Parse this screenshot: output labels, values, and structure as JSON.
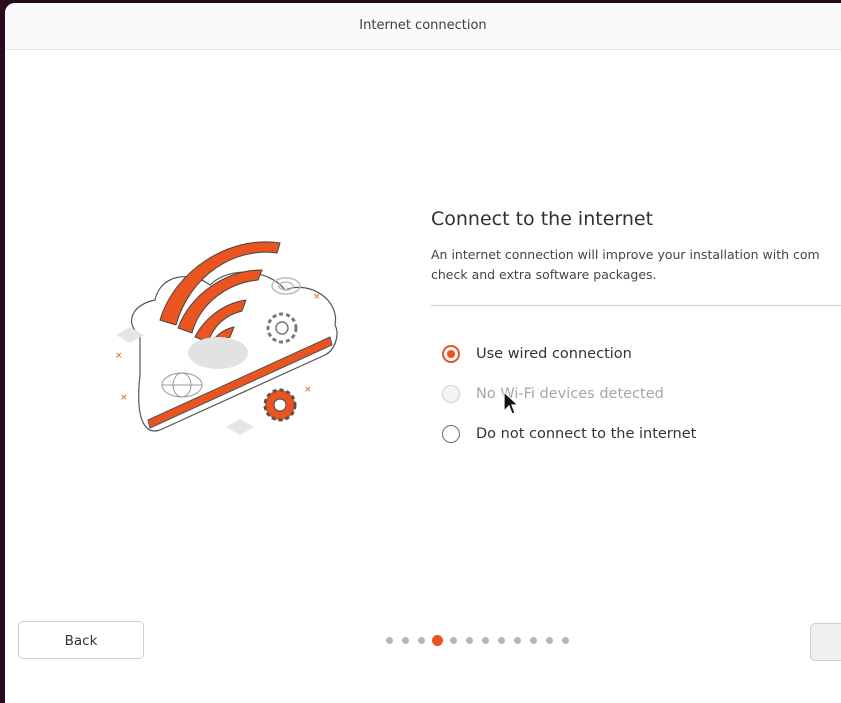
{
  "window": {
    "title": "Internet connection"
  },
  "main": {
    "heading": "Connect to the internet",
    "description_line1": "An internet connection will improve your installation with com",
    "description_line2": "check and extra software packages."
  },
  "options": [
    {
      "label": "Use wired connection",
      "state": "selected"
    },
    {
      "label": "No Wi-Fi devices detected",
      "state": "disabled"
    },
    {
      "label": "Do not connect to the internet",
      "state": "unselected"
    }
  ],
  "footer": {
    "back_label": "Back",
    "progress": {
      "total_steps": 12,
      "current_step": 4
    }
  },
  "colors": {
    "accent": "#e95420",
    "desktop_background": "#2c0a1e"
  }
}
